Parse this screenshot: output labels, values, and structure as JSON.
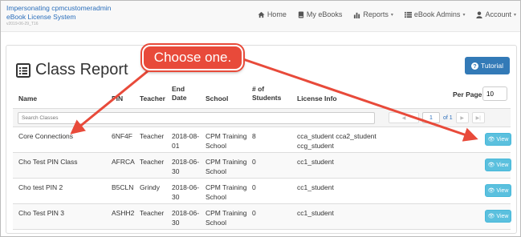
{
  "navbar": {
    "brand_line1": "Impersonating cpmcustomeradmin",
    "brand_line2": "eBook License System",
    "version": "v2019-06-29_T16",
    "links": [
      {
        "label": "Home",
        "icon": "home-icon"
      },
      {
        "label": "My eBooks",
        "icon": "book-icon"
      },
      {
        "label": "Reports",
        "icon": "bar-chart-icon",
        "caret": "▾"
      },
      {
        "label": "eBook Admins",
        "icon": "list-icon",
        "caret": "▾"
      },
      {
        "label": "Account",
        "icon": "user-icon",
        "caret": "▾"
      }
    ]
  },
  "page": {
    "title": "Class Report",
    "tutorial_label": "Tutorial"
  },
  "table": {
    "headers": {
      "name": "Name",
      "pin": "PIN",
      "teacher": "Teacher",
      "end_date_1": "End",
      "end_date_2": "Date",
      "school": "School",
      "students_1": "# of",
      "students_2": "Students",
      "license": "License Info"
    },
    "per_page_label": "Per Page:",
    "per_page_value": "10",
    "search_placeholder": "Search Classes",
    "pager": {
      "page": "1",
      "of_label": "of 1"
    },
    "view_label": "View",
    "rows": [
      {
        "name": "Core Connections",
        "pin": "6NF4F",
        "teacher": "Teacher",
        "date1": "2018-08-",
        "date2": "01",
        "school1": "CPM Training",
        "school2": "School",
        "students": "8",
        "license1": "cca_student cca2_student",
        "license2": "ccg_student"
      },
      {
        "name": "Cho Test PIN Class",
        "pin": "AFRCA",
        "teacher": "Teacher",
        "date1": "2018-06-",
        "date2": "30",
        "school1": "CPM Training",
        "school2": "School",
        "students": "0",
        "license1": "cc1_student",
        "license2": ""
      },
      {
        "name": "Cho test PIN 2",
        "pin": "B5CLN",
        "teacher": "Grindy",
        "date1": "2018-06-",
        "date2": "30",
        "school1": "CPM Training",
        "school2": "School",
        "students": "0",
        "license1": "cc1_student",
        "license2": ""
      },
      {
        "name": "Cho Test PIN 3",
        "pin": "ASHH2",
        "teacher": "Teacher",
        "date1": "2018-06-",
        "date2": "30",
        "school1": "CPM Training",
        "school2": "School",
        "students": "0",
        "license1": "cc1_student",
        "license2": ""
      }
    ]
  },
  "annotation": {
    "callout_text": "Choose one.",
    "color": "#e84a3a"
  },
  "colors": {
    "brand": "#2a6ebb",
    "primary_button": "#337ab7",
    "info_button": "#5bc0de"
  }
}
